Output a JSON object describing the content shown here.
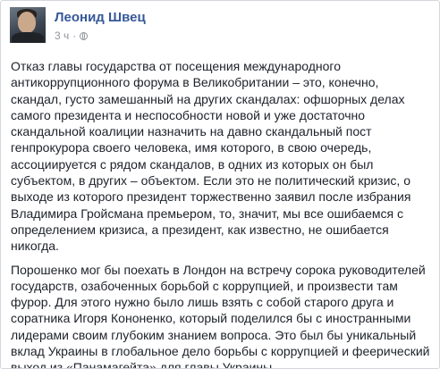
{
  "post": {
    "author": "Леонид Швец",
    "time": "3 ч",
    "separator": "·",
    "privacy_icon": "globe-icon",
    "paragraphs": [
      "Отказ главы государства от посещения международного антикоррупционного форума в Великобритании – это, конечно, скандал, густо замешанный на других скандалах: офшорных делах самого президента и неспособности новой и уже достаточно скандальной коалиции назначить на давно скандальный пост генпрокурора своего человека, имя которого, в свою очередь, ассоциируется с рядом скандалов, в одних из которых он был субъектом, в других – объектом. Если это не политический кризис, о выходе из которого президент торжественно заявил после избрания Владимира Гройсмана премьером, то, значит, мы все ошибаемся с определением кризиса, а президент, как известно, не ошибается никогда.",
      "Порошенко мог бы поехать в Лондон на встречу сорока руководителей государств, озабоченных борьбой с коррупцией, и произвести там фурор. Для этого нужно было лишь взять с собой старого друга и соратника Игоря Кононенко, который поделился бы с иностранными лидерами своим глубоким знанием вопроса. Это был бы уникальный вклад Украины в глобальное дело борьбы с коррупцией и феерический выход из «Панамагейта» для главы Украины."
    ]
  },
  "colors": {
    "author_link": "#365899",
    "meta_text": "#90949c",
    "body_text": "#1d2129"
  }
}
